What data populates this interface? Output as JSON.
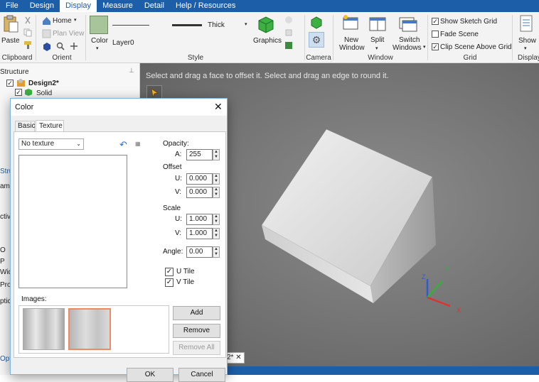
{
  "menu": {
    "tabs": [
      "File",
      "Design",
      "Display",
      "Measure",
      "Detail",
      "Help / Resources"
    ],
    "active_index": 2
  },
  "ribbon": {
    "clipboard": {
      "label": "Clipboard",
      "paste": "Paste"
    },
    "orient": {
      "label": "Orient",
      "home": "Home",
      "plan_view": "Plan View"
    },
    "style": {
      "label": "Style",
      "color": "Color",
      "layer": "Layer0",
      "line_weight": "Thick"
    },
    "graphics": {
      "label": "Graphics"
    },
    "camera": {
      "label": "Camera"
    },
    "window": {
      "label": "Window",
      "new_window_line1": "New",
      "new_window_line2": "Window",
      "split": "Split",
      "switch_line1": "Switch",
      "switch_line2": "Windows"
    },
    "grid": {
      "label": "Grid",
      "show_sketch_grid": "Show Sketch Grid",
      "show_sketch_grid_checked": true,
      "fade_scene": "Fade Scene",
      "fade_scene_checked": false,
      "clip_scene": "Clip Scene Above Grid",
      "clip_scene_checked": true
    },
    "show": {
      "label": "Display",
      "show": "Show"
    }
  },
  "structure": {
    "header": "Structure",
    "design": "Design2*",
    "solid": "Solid",
    "partial_labels": [
      "Stru",
      "ame",
      "ctiv",
      "O",
      "P",
      "Widt",
      "Prop",
      "ptic",
      "Opt"
    ]
  },
  "viewport": {
    "hint": "Select and drag a face to offset it. Select and drag an edge to round it.",
    "tab": "2*",
    "axis_x": "X",
    "axis_y": "Y",
    "axis_z": "Z"
  },
  "dialog": {
    "title": "Color",
    "tabs": [
      "Basic",
      "Texture"
    ],
    "active_tab": 1,
    "texture_select": "No texture",
    "opacity_label": "Opacity:",
    "a_label": "A:",
    "a_value": "255",
    "offset_label": "Offset",
    "offset_u_label": "U:",
    "offset_u": "0.000",
    "offset_v_label": "V:",
    "offset_v": "0.000",
    "scale_label": "Scale",
    "scale_u_label": "U:",
    "scale_u": "1.000",
    "scale_v_label": "V:",
    "scale_v": "1.000",
    "angle_label": "Angle:",
    "angle": "0.00",
    "u_tile": "U Tile",
    "u_tile_checked": true,
    "v_tile": "V Tile",
    "v_tile_checked": true,
    "images_label": "Images:",
    "add": "Add",
    "remove": "Remove",
    "remove_all": "Remove All",
    "ok": "OK",
    "cancel": "Cancel"
  }
}
